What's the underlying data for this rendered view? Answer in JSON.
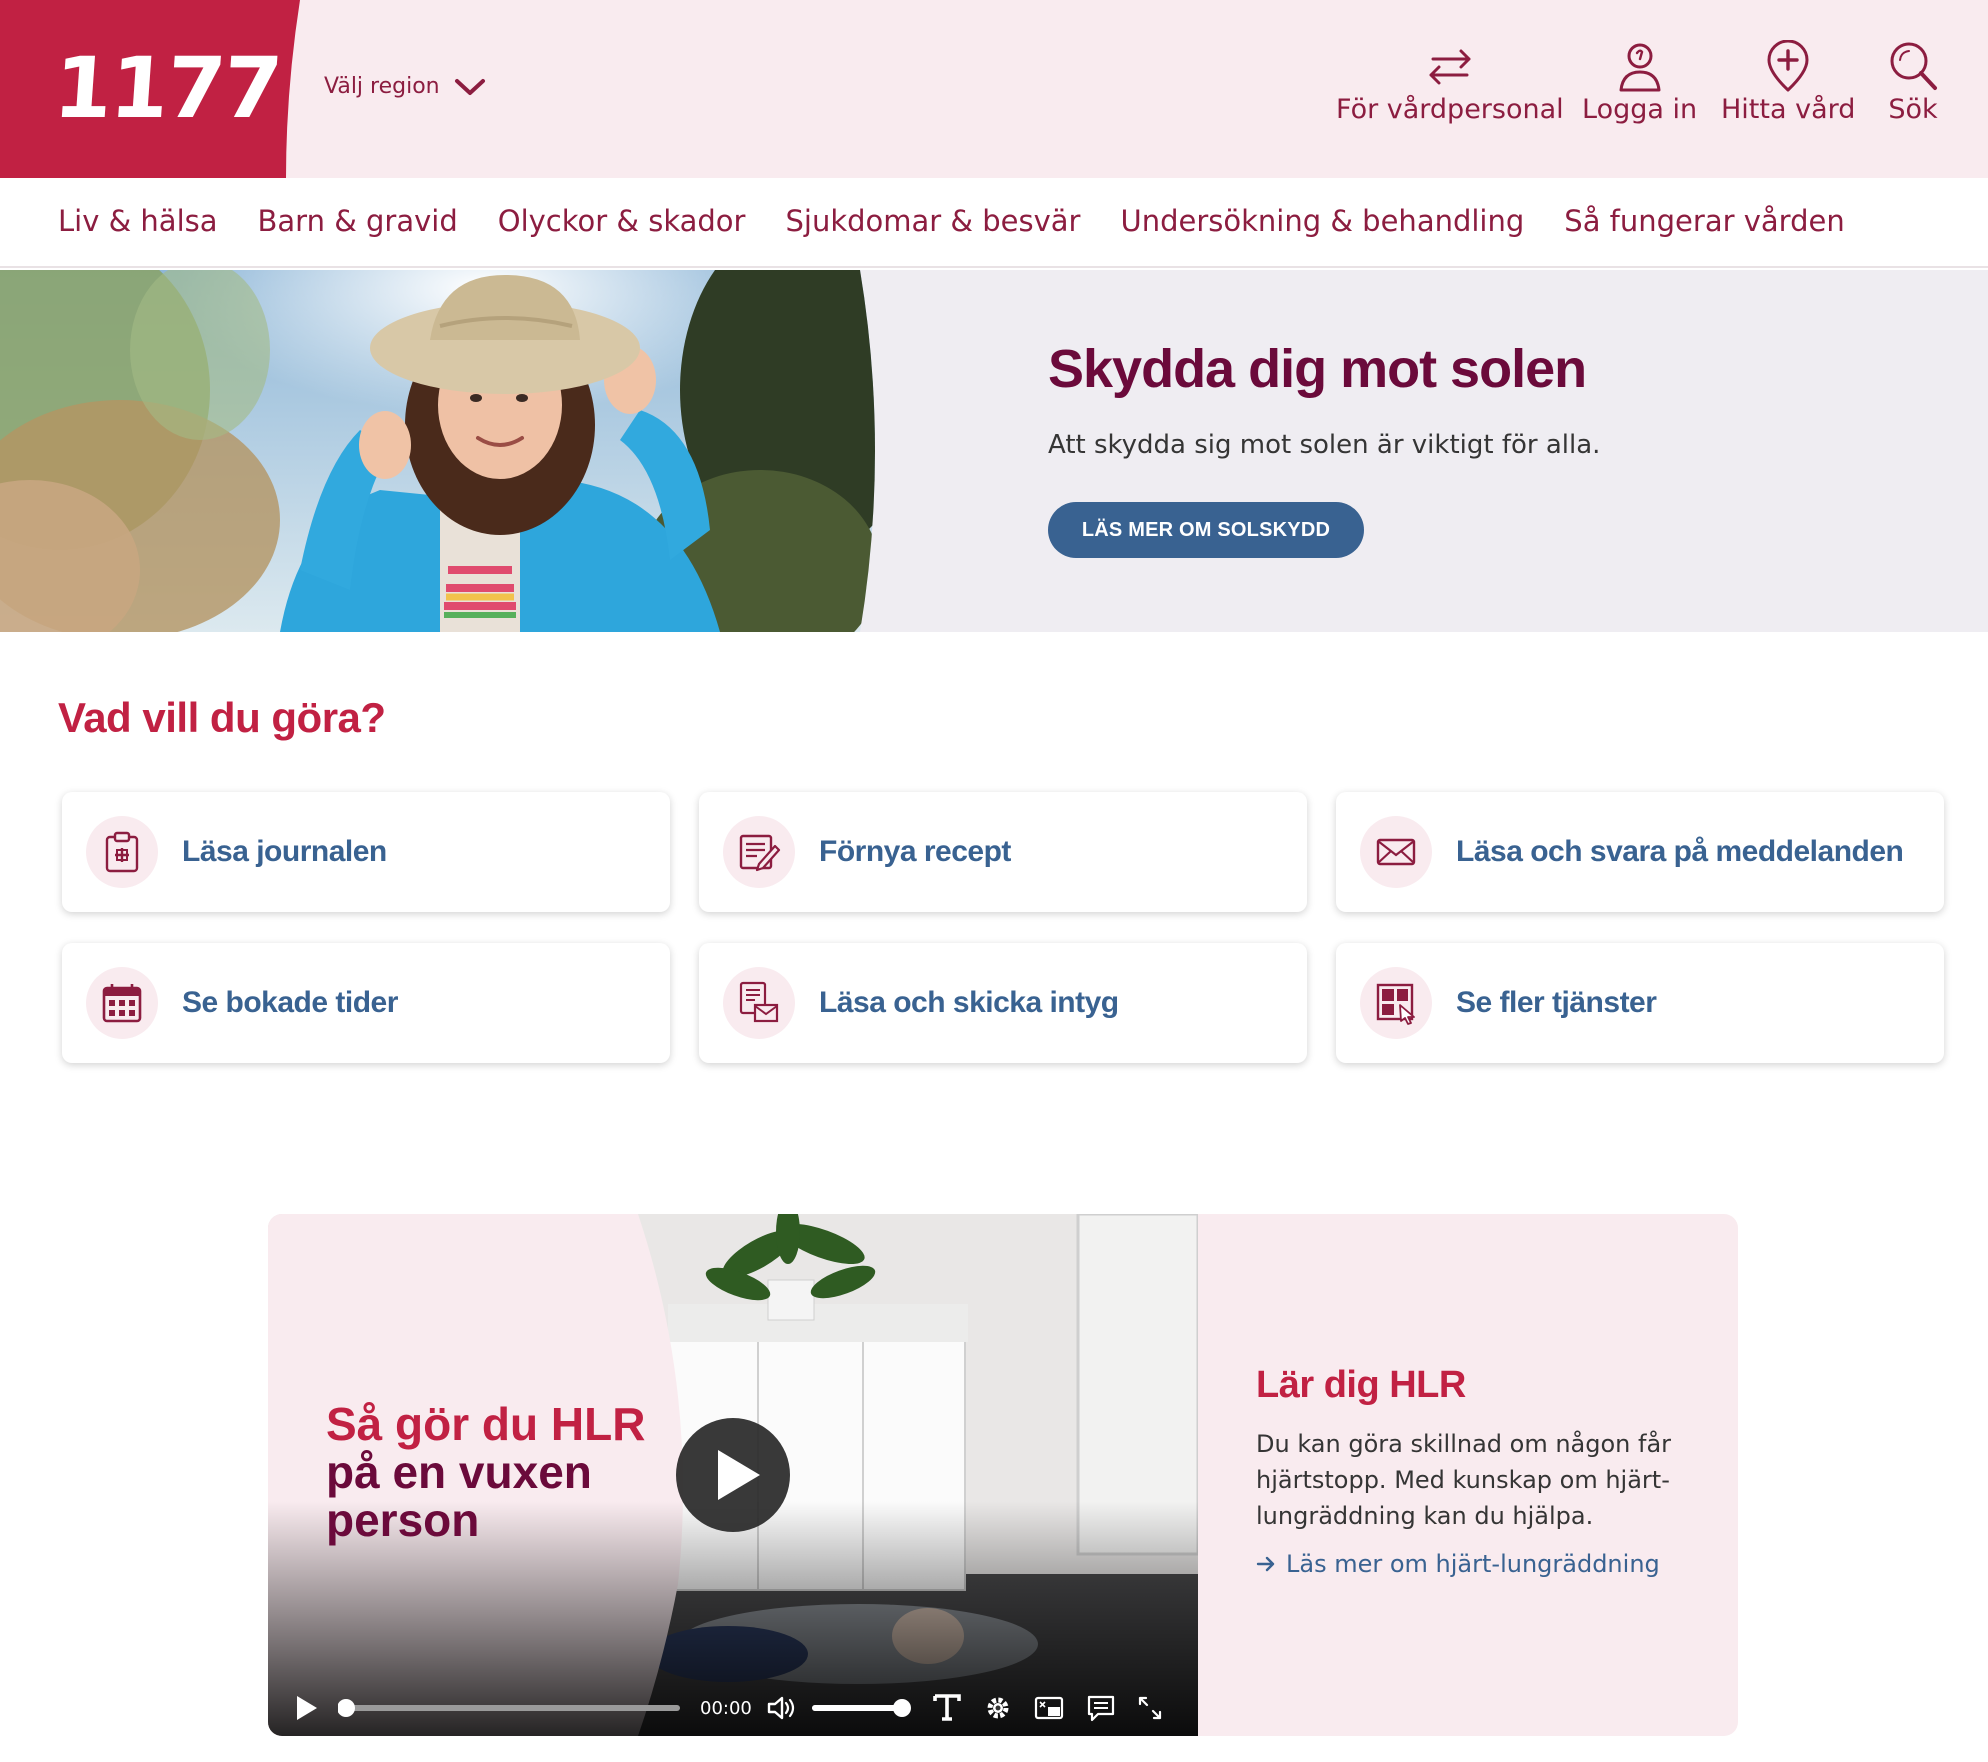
{
  "header": {
    "logo_text": "1177",
    "region_label": "Välj region",
    "utilities": [
      {
        "label": "För vårdpersonal",
        "icon": "arrows-swap-icon"
      },
      {
        "label": "Logga in",
        "icon": "user-icon"
      },
      {
        "label": "Hitta vård",
        "icon": "map-pin-cross-icon"
      },
      {
        "label": "Sök",
        "icon": "search-icon"
      }
    ],
    "brand_color": "#c12143"
  },
  "nav": {
    "items": [
      "Liv & hälsa",
      "Barn & gravid",
      "Olyckor & skador",
      "Sjukdomar & besvär",
      "Undersökning & behandling",
      "Så fungerar vården"
    ]
  },
  "hero": {
    "title": "Skydda dig mot solen",
    "lead": "Att skydda sig mot solen är viktigt för alla.",
    "button": "LÄS MER OM SOLSKYDD"
  },
  "services": {
    "title": "Vad vill du göra?",
    "cards": [
      {
        "label": "Läsa journalen",
        "icon": "clipboard-medical-icon"
      },
      {
        "label": "Förnya recept",
        "icon": "prescription-pen-icon"
      },
      {
        "label": "Läsa och svara på meddelanden",
        "icon": "envelope-icon"
      },
      {
        "label": "Se bokade tider",
        "icon": "calendar-icon"
      },
      {
        "label": "Läsa och skicka intyg",
        "icon": "document-envelope-icon"
      },
      {
        "label": "Se fler tjänster",
        "icon": "grid-cursor-icon"
      }
    ]
  },
  "video": {
    "title_line1": "Så gör du HLR",
    "title_line2": "på en vuxen",
    "title_line3": "person",
    "time": "00:00",
    "progress": 0,
    "volume": 1.0
  },
  "hlr": {
    "title": "Lär dig HLR",
    "text": "Du kan göra skillnad om någon får hjärtstopp. Med kunskap om hjärt-lungräddning kan du hjälpa.",
    "link": "Läs mer om hjärt-lungräddning"
  }
}
